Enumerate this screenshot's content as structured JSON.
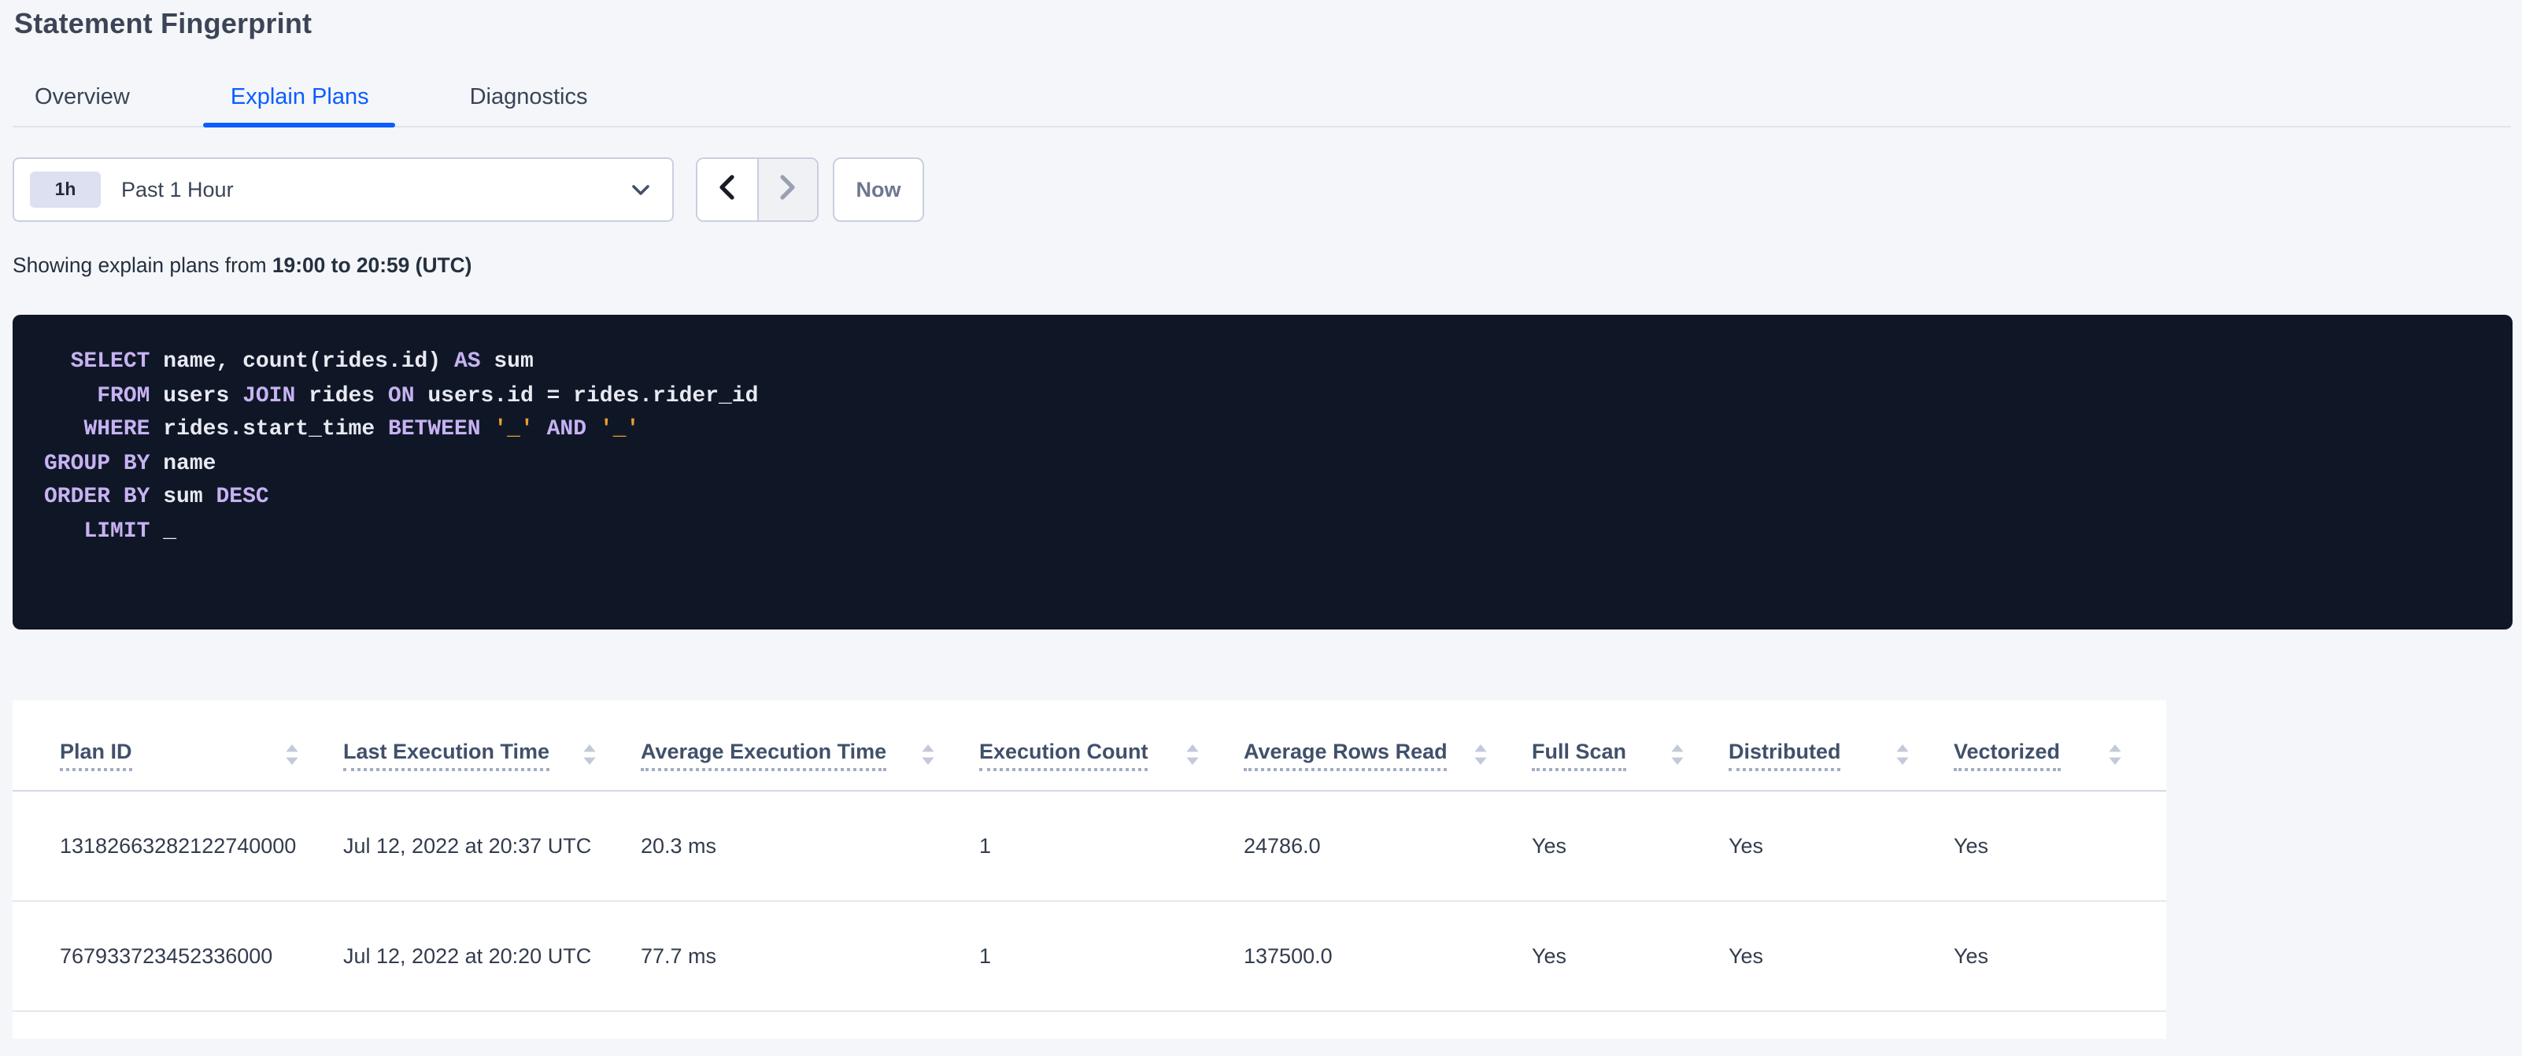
{
  "page": {
    "title": "Statement Fingerprint"
  },
  "tabs": [
    {
      "label": "Overview",
      "active": false
    },
    {
      "label": "Explain Plans",
      "active": true
    },
    {
      "label": "Diagnostics",
      "active": false
    }
  ],
  "time_picker": {
    "preset_badge": "1h",
    "selected": "Past 1 Hour",
    "dropdown_icon": "chevron-down-icon",
    "prev_icon": "chevron-left-icon",
    "next_icon": "chevron-right-icon",
    "next_disabled": true,
    "now_label": "Now"
  },
  "range_summary": {
    "prefix": "Showing explain plans from ",
    "range": "19:00 to 20:59 (UTC)"
  },
  "sql": {
    "lines": [
      [
        {
          "t": "pl",
          "v": "  "
        },
        {
          "t": "kw",
          "v": "SELECT"
        },
        {
          "t": "pl",
          "v": " name, count(rides.id) "
        },
        {
          "t": "kw",
          "v": "AS"
        },
        {
          "t": "pl",
          "v": " sum"
        }
      ],
      [
        {
          "t": "pl",
          "v": "    "
        },
        {
          "t": "kw",
          "v": "FROM"
        },
        {
          "t": "pl",
          "v": " users "
        },
        {
          "t": "kw",
          "v": "JOIN"
        },
        {
          "t": "pl",
          "v": " rides "
        },
        {
          "t": "kw",
          "v": "ON"
        },
        {
          "t": "pl",
          "v": " users.id = rides.rider_id"
        }
      ],
      [
        {
          "t": "pl",
          "v": "   "
        },
        {
          "t": "kw",
          "v": "WHERE"
        },
        {
          "t": "pl",
          "v": " rides.start_time "
        },
        {
          "t": "kw",
          "v": "BETWEEN"
        },
        {
          "t": "pl",
          "v": " "
        },
        {
          "t": "lit",
          "v": "'_'"
        },
        {
          "t": "pl",
          "v": " "
        },
        {
          "t": "kw",
          "v": "AND"
        },
        {
          "t": "pl",
          "v": " "
        },
        {
          "t": "lit",
          "v": "'_'"
        }
      ],
      [
        {
          "t": "kw",
          "v": "GROUP BY"
        },
        {
          "t": "pl",
          "v": " name"
        }
      ],
      [
        {
          "t": "kw",
          "v": "ORDER BY"
        },
        {
          "t": "pl",
          "v": " sum "
        },
        {
          "t": "kw",
          "v": "DESC"
        }
      ],
      [
        {
          "t": "pl",
          "v": "   "
        },
        {
          "t": "kw",
          "v": "LIMIT"
        },
        {
          "t": "pl",
          "v": " _"
        }
      ]
    ]
  },
  "table": {
    "sort_icon": "sort-icon",
    "columns": [
      {
        "key": "plan_id",
        "label": "Plan ID",
        "sortable": true
      },
      {
        "key": "last_execution_time",
        "label": "Last Execution Time",
        "sortable": true
      },
      {
        "key": "average_execution_time",
        "label": "Average Execution Time",
        "sortable": true
      },
      {
        "key": "execution_count",
        "label": "Execution Count",
        "sortable": true
      },
      {
        "key": "average_rows_read",
        "label": "Average Rows Read",
        "sortable": true
      },
      {
        "key": "full_scan",
        "label": "Full Scan",
        "sortable": true
      },
      {
        "key": "distributed",
        "label": "Distributed",
        "sortable": true
      },
      {
        "key": "vectorized",
        "label": "Vectorized",
        "sortable": true
      }
    ],
    "rows": [
      {
        "plan_id": "13182663282122740000",
        "last_execution_time": "Jul 12, 2022 at 20:37 UTC",
        "average_execution_time": "20.3 ms",
        "execution_count": "1",
        "average_rows_read": "24786.0",
        "full_scan": "Yes",
        "distributed": "Yes",
        "vectorized": "Yes"
      },
      {
        "plan_id": "767933723452336000",
        "last_execution_time": "Jul 12, 2022 at 20:20 UTC",
        "average_execution_time": "77.7 ms",
        "execution_count": "1",
        "average_rows_read": "137500.0",
        "full_scan": "Yes",
        "distributed": "Yes",
        "vectorized": "Yes"
      }
    ]
  },
  "colors": {
    "accent_blue": "#0b5dff",
    "page_bg": "#f4f6fa",
    "code_bg": "#0f1727",
    "code_keyword": "#c7b2f2",
    "code_text": "#e8eaf2",
    "code_literal": "#eb9f34"
  }
}
